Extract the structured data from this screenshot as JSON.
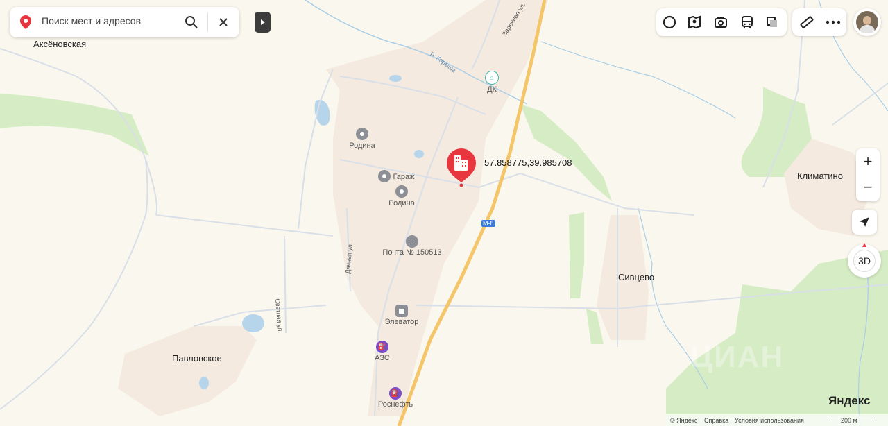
{
  "search": {
    "placeholder": "Поиск мест и адресов"
  },
  "marker": {
    "coords": "57.858775,39.985708",
    "color": "#e8363f"
  },
  "places": {
    "aksenovskaya": "Аксёновская",
    "klimatino": "Климатино",
    "sivtsevo": "Сивцево",
    "pavlovskoe": "Павловское"
  },
  "pois": {
    "dk": "ДК",
    "rodina1": "Родина",
    "garage": "Гараж",
    "rodina2": "Родина",
    "post": "Почта № 150513",
    "elevator": "Элеватор",
    "azs": "АЗС",
    "rosneft": "Роснефть"
  },
  "streets": {
    "river": "р. Кормша",
    "zarechnaya": "Заречная ул.",
    "dachnaya": "Дачная ул.",
    "svetlaya": "Светлая ул."
  },
  "road_label": "М-8",
  "controls": {
    "zoom_in": "+",
    "zoom_out": "−",
    "mode_3d": "3D"
  },
  "brand": "Яндекс",
  "watermark": "ЦИАН",
  "footer": {
    "copyright": "© Яндекс",
    "help": "Справка",
    "terms": "Условия использования",
    "scale": "200 м"
  },
  "colors": {
    "background": "#faf8ee",
    "forest": "#d5ecc4",
    "settlement": "#f4eadf",
    "highway": "#f5c56a",
    "road": "#d9dfe8",
    "water": "#b6d4ea",
    "poi": "#8c8f96",
    "azs": "#7a4bc7"
  }
}
